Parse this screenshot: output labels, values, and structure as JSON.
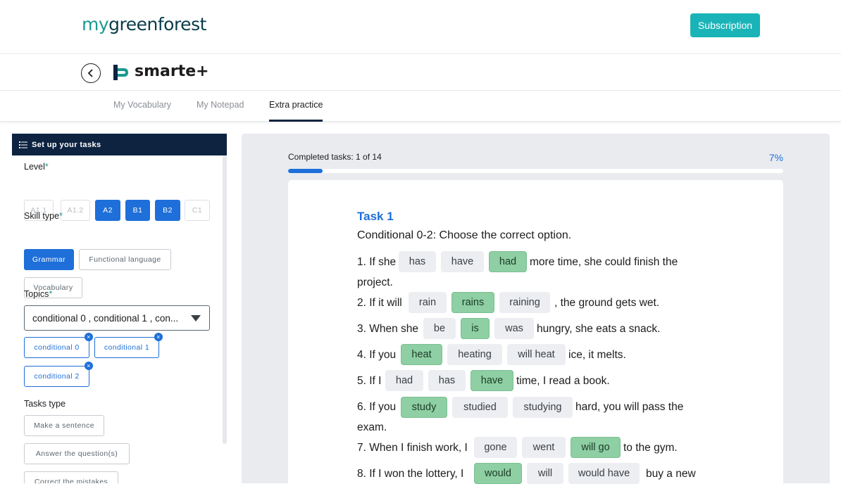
{
  "header": {
    "logo_my": "my",
    "logo_rest": "greenforest",
    "subscription_label": "Subscription"
  },
  "brand": {
    "name": "smarte+"
  },
  "tabs": [
    {
      "label": "My Vocabulary"
    },
    {
      "label": "My Notepad"
    },
    {
      "label": "Extra practice"
    }
  ],
  "sidebar": {
    "title": "Set up your tasks",
    "level_label": "Level",
    "levels": [
      "A1.1",
      "A1.2",
      "A2",
      "B1",
      "B2",
      "C1"
    ],
    "skill_label": "Skill type",
    "skills": [
      "Grammar",
      "Functional language",
      "Vocabulary"
    ],
    "topics_label": "Topics",
    "topics_value": "conditional 0 , conditional 1 , con...",
    "topic_tags": [
      "conditional 0",
      "conditional 1",
      "conditional 2"
    ],
    "tasks_type_label": "Tasks type",
    "task_types": [
      "Make a sentence",
      "Answer the question(s)",
      "Correct the mistakes"
    ],
    "required_mark": "*",
    "remove_mark": "×"
  },
  "progress": {
    "label": "Completed tasks: 1 of 14",
    "percent_label": "7%",
    "fraction": 0.07
  },
  "task": {
    "title": "Task 1",
    "instruction": "Conditional 0-2: Choose the correct option.",
    "questions": [
      {
        "prefix": "1. If she",
        "options": [
          "has",
          "have",
          "had"
        ],
        "suffix": "more time, she could finish the",
        "cont": "project."
      },
      {
        "prefix": "2. If it will",
        "options": [
          "rain",
          "rains",
          "raining"
        ],
        "suffix": ", the ground gets wet."
      },
      {
        "prefix": "3. When she",
        "options": [
          "be",
          "is",
          "was"
        ],
        "suffix": "hungry, she eats a snack."
      },
      {
        "prefix": "4. If you",
        "options": [
          "heat",
          "heating",
          "will heat"
        ],
        "suffix": "ice, it melts."
      },
      {
        "prefix": "5. If I",
        "options": [
          "had",
          "has",
          "have"
        ],
        "suffix": "time, I read a book."
      },
      {
        "prefix": "6. If you",
        "options": [
          "study",
          "studied",
          "studying"
        ],
        "suffix": "hard, you will pass the",
        "cont": "exam."
      },
      {
        "prefix": "7. When I finish work, I",
        "options": [
          "gone",
          "went",
          "will go"
        ],
        "suffix": "to the gym."
      },
      {
        "prefix": "8. If I won the lottery, I",
        "options": [
          "would",
          "will",
          "would have"
        ],
        "suffix": "buy a new"
      }
    ]
  }
}
